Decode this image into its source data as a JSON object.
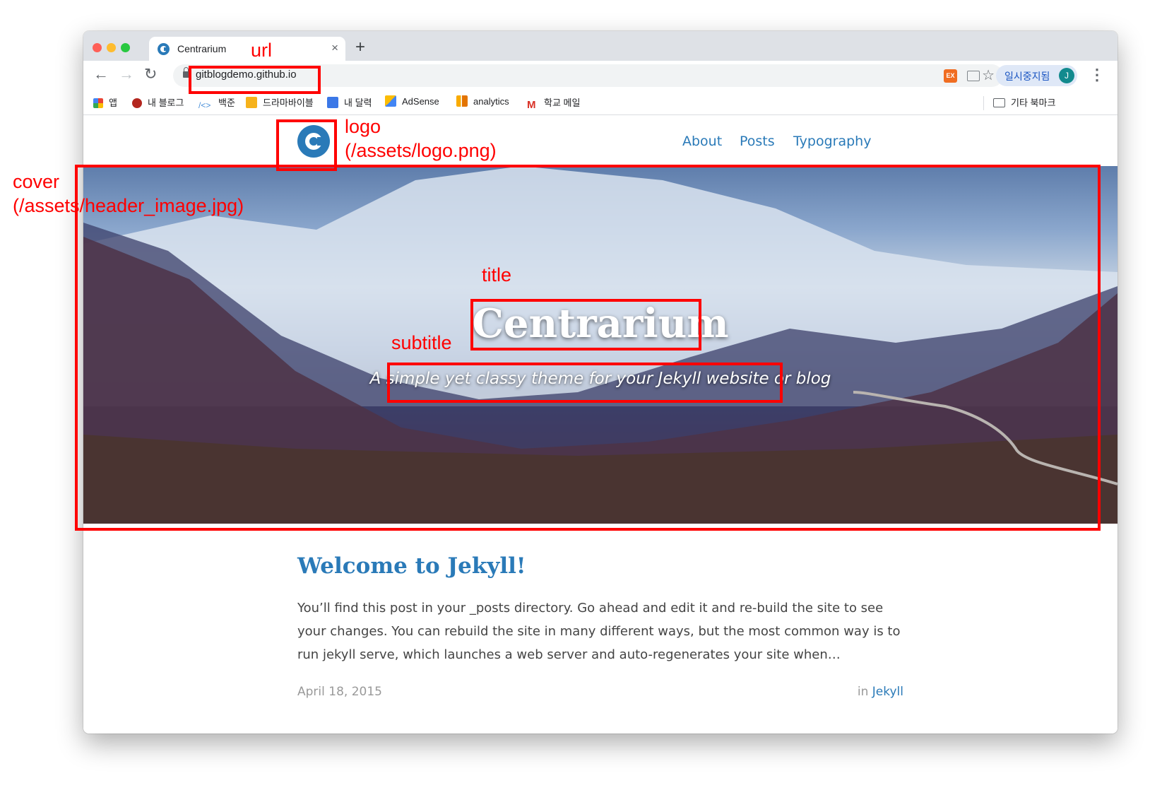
{
  "browser": {
    "tab_title": "Centrarium",
    "tab_close": "×",
    "new_tab": "+",
    "url": "gitblogdemo.github.io",
    "ext_badge": "EX",
    "profile_label": "일시중지됨",
    "profile_initial": "J",
    "bookmarks": [
      {
        "label": "앱",
        "icon": "apps-grid-icon"
      },
      {
        "label": "내 블로그",
        "icon": "blog-icon"
      },
      {
        "label": "백준",
        "icon": "code-brackets-icon"
      },
      {
        "label": "드라마바이블",
        "icon": "bulb-icon"
      },
      {
        "label": "내 달력",
        "icon": "calendar-icon"
      },
      {
        "label": "AdSense",
        "icon": "adsense-icon"
      },
      {
        "label": "analytics",
        "icon": "analytics-icon"
      },
      {
        "label": "학교 메일",
        "icon": "gmail-icon"
      }
    ],
    "other_bookmarks": "기타 북마크"
  },
  "site": {
    "nav": [
      "About",
      "Posts",
      "Typography"
    ],
    "title": "Centrarium",
    "subtitle": "A simple yet classy theme for your Jekyll website or blog"
  },
  "post": {
    "title": "Welcome to Jekyll!",
    "excerpt": "You’ll find this post in your _posts directory. Go ahead and edit it and re-build the site to see your changes. You can rebuild the site in many different ways, but the most common way is to run jekyll serve, which launches a web server and auto-regenerates your site when…",
    "date": "April 18, 2015",
    "category_prefix": "in",
    "category": "Jekyll"
  },
  "annotations": {
    "url": "url",
    "logo": "logo",
    "logo_path": "(/assets/logo.png)",
    "cover": "cover",
    "cover_path": "(/assets/header_image.jpg)",
    "title": "title",
    "subtitle": "subtitle"
  },
  "colors": {
    "link": "#2a7ab8",
    "annotation": "#ff0000"
  }
}
